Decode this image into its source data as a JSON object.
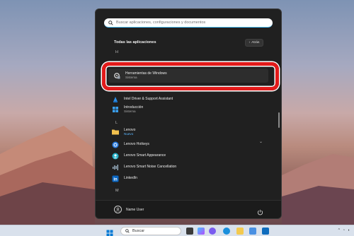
{
  "search": {
    "placeholder": "Buscar aplicaciones, configuraciones y documentos"
  },
  "all_apps": {
    "title": "Todas las aplicaciones",
    "back_label": "Atrás"
  },
  "groups": [
    {
      "letter": "H"
    },
    {
      "letter": "I"
    },
    {
      "letter": "L"
    },
    {
      "letter": "M"
    }
  ],
  "apps": [
    {
      "name": "Herramientas de Windows",
      "sub": "Sistema"
    },
    {
      "name": "Intel Driver & Support Assistant"
    },
    {
      "name": "Introducción",
      "sub": "Sistema"
    },
    {
      "name": "Lenovo",
      "sub": "Nuevo"
    },
    {
      "name": "Lenovo Hotkeys"
    },
    {
      "name": "Lenovo Smart Appearance"
    },
    {
      "name": "Lenovo Smart Noise Cancellation"
    },
    {
      "name": "LinkedIn"
    }
  ],
  "footer": {
    "user_name": "Name User"
  },
  "taskbar": {
    "search_label": "Buscar"
  },
  "colors": {
    "highlight": "#e21a1a",
    "accent": "#4cc2ff",
    "new_badge": "#5ab6ff"
  }
}
